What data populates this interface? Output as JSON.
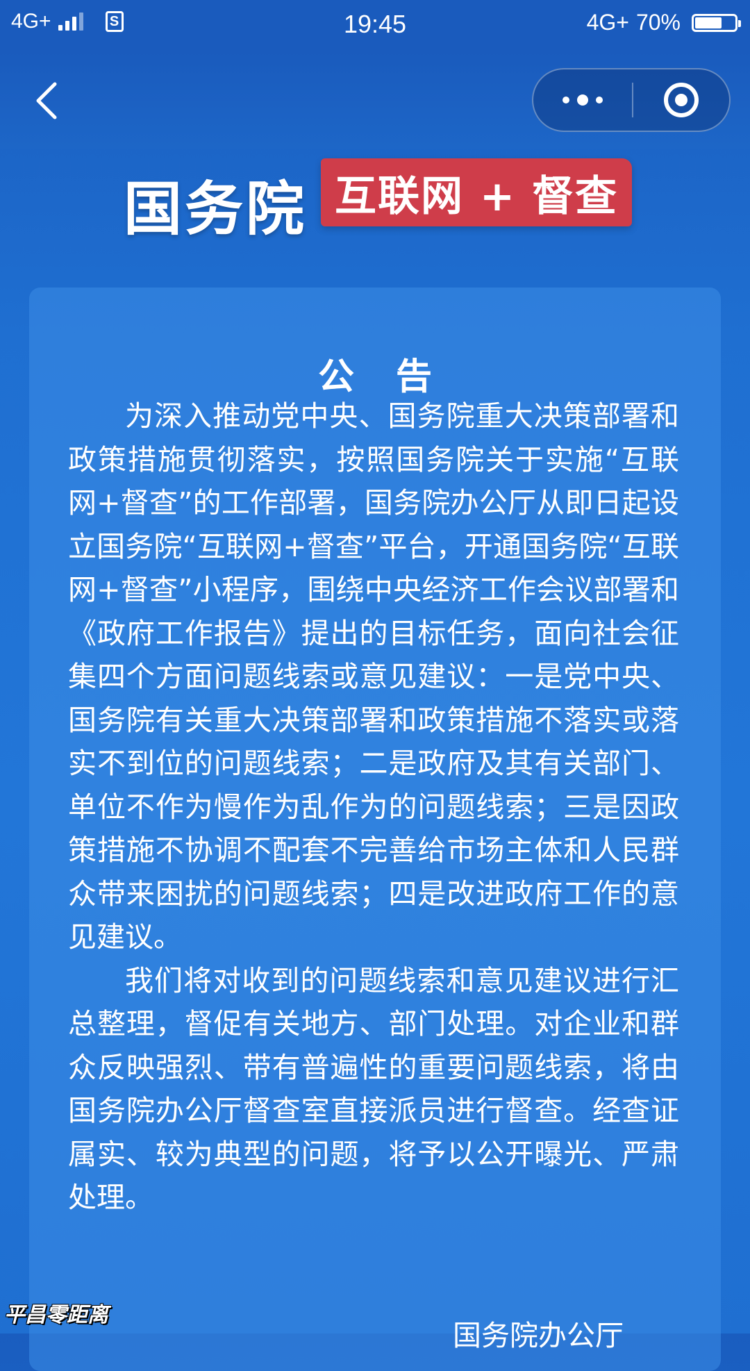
{
  "status_bar": {
    "network": "4G+",
    "app_icon_letter": "S",
    "time": "19:45",
    "right_network": "4G+",
    "battery_percent": "70%",
    "battery_level": 0.7
  },
  "nav": {
    "back_icon": "chevron-left-icon",
    "more_icon": "more-dots-icon",
    "close_icon": "target-close-icon"
  },
  "banner": {
    "title": "国务院",
    "badge": "互联网 + 督查",
    "badge_color": "#cf3d4a"
  },
  "notice": {
    "title": "公告",
    "paragraphs": [
      "为深入推动党中央、国务院重大决策部署和政策措施贯彻落实，按照国务院关于实施“互联网+督查”的工作部署，国务院办公厅从即日起设立国务院“互联网+督查”平台，开通国务院“互联网+督查”小程序，围绕中央经济工作会议部署和《政府工作报告》提出的目标任务，面向社会征集四个方面问题线索或意见建议：一是党中央、国务院有关重大决策部署和政策措施不落实或落实不到位的问题线索；二是政府及其有关部门、单位不作为慢作为乱作为的问题线索；三是因政策措施不协调不配套不完善给市场主体和人民群众带来困扰的问题线索；四是改进政府工作的意见建议。",
      "我们将对收到的问题线索和意见建议进行汇总整理，督促有关地方、部门处理。对企业和群众反映强烈、带有普遍性的重要问题线索，将由国务院办公厅督查室直接派员进行督查。经查证属实、较为典型的问题，将予以公开曝光、严肃处理。"
    ],
    "signature": "国务院办公厅"
  },
  "watermark": "平昌零距离",
  "colors": {
    "background": "#1f6fd1",
    "card": "#3c8ce6"
  }
}
